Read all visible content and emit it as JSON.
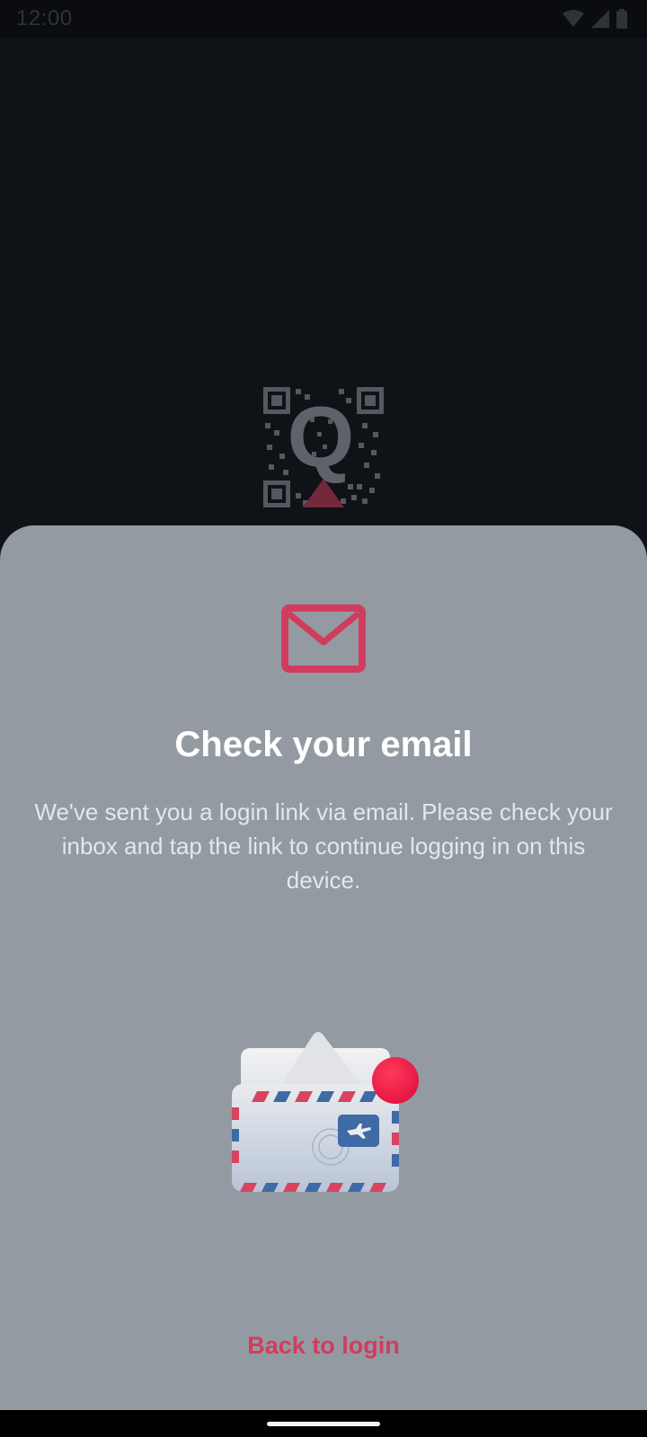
{
  "status_bar": {
    "time": "12:00",
    "icons": [
      "wifi-icon",
      "signal-icon",
      "battery-icon"
    ]
  },
  "app": {
    "logo_name": "qr-q-logo"
  },
  "sheet": {
    "icon": "mail-icon",
    "title": "Check your email",
    "body": "We've sent you a login link via email. Please check your inbox and tap the link to continue logging in on this device.",
    "illustration": "airmail-envelope-illustration",
    "back_label": "Back to login"
  },
  "colors": {
    "background": "#0f1217",
    "sheet": "#939aa2",
    "accent": "#d13c5e",
    "title": "#ffffff",
    "body_text": "#e4e7eb"
  }
}
